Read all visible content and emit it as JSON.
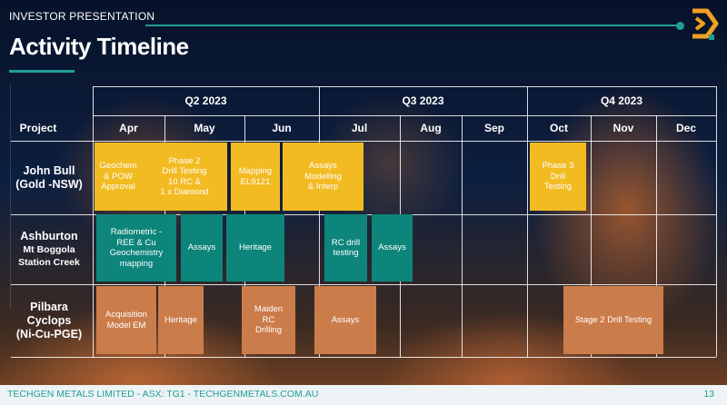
{
  "header": {
    "section_label": "INVESTOR PRESENTATION",
    "title": "Activity Timeline"
  },
  "table": {
    "project_header": "Project",
    "quarters": [
      "Q2 2023",
      "Q3 2023",
      "Q4 2023"
    ],
    "months": [
      "Apr",
      "May",
      "Jun",
      "Jul",
      "Aug",
      "Sep",
      "Oct",
      "Nov",
      "Dec"
    ],
    "projects": [
      {
        "name": "John Bull",
        "detail": "(Gold -NSW)"
      },
      {
        "name": "Ashburton",
        "detail": "Mt Boggola\nStation Creek"
      },
      {
        "name": "Pilbara\nCyclops",
        "detail": "(Ni-Cu-PGE)"
      }
    ],
    "activities": [
      {
        "label": "Geochem\n& POW\nApproval",
        "color": "gold"
      },
      {
        "label": "Phase 2\nDrill Testing\n10 RC &\n1 x Diamond",
        "color": "gold"
      },
      {
        "label": "Mapping\nEL9121",
        "color": "gold"
      },
      {
        "label": "Assays\nModelling\n& Interp",
        "color": "gold"
      },
      {
        "label": "Phase 3\nDrill\nTesting",
        "color": "gold"
      },
      {
        "label": "Radiometric -\nREE & Cu\nGeochemistry\nmapping",
        "color": "teal"
      },
      {
        "label": "Assays",
        "color": "teal"
      },
      {
        "label": "Heritage",
        "color": "teal"
      },
      {
        "label": "RC drill\ntesting",
        "color": "teal"
      },
      {
        "label": "Assays",
        "color": "teal"
      },
      {
        "label": "Acquisition\nModel EM",
        "color": "copper"
      },
      {
        "label": "Heritage",
        "color": "copper"
      },
      {
        "label": "Maiden\nRC\nDrilling",
        "color": "copper"
      },
      {
        "label": "Assays",
        "color": "copper"
      },
      {
        "label": "Stage 2 Drill Testing",
        "color": "copper"
      }
    ]
  },
  "footer": {
    "company": "TECHGEN METALS LIMITED - ASX: TG1 - TECHGENMETALS.COM.AU",
    "page_number": "13"
  },
  "colors": {
    "accent_teal": "#1f9e95",
    "gold": "#f2bb22",
    "teal": "#0d857a",
    "copper": "#cb7c4b",
    "logo_orange": "#f0a020"
  },
  "icons": {
    "logo": "techgen-chevron-logo"
  }
}
